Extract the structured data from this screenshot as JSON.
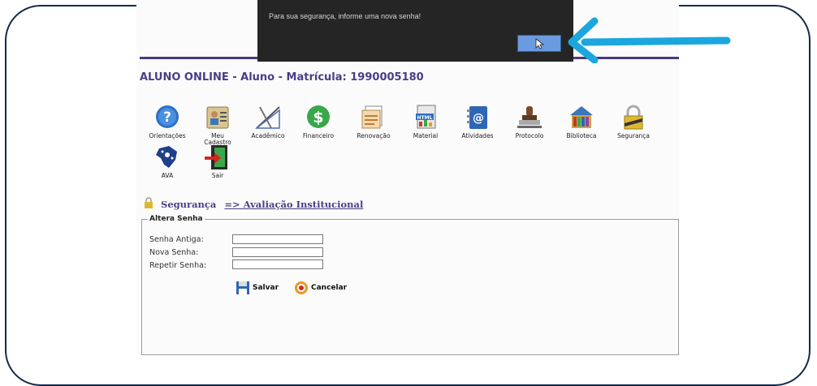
{
  "alert": {
    "message": "Para sua segurança, informe uma nova senha!"
  },
  "header": {
    "title": "ALUNO ONLINE - Aluno - Matrícula: 1990005180"
  },
  "menu": [
    {
      "label": "Orientações",
      "icon": "question-icon"
    },
    {
      "label": "Meu\nCadastro",
      "icon": "id-card-icon"
    },
    {
      "label": "Acadêmico",
      "icon": "drafting-tools-icon"
    },
    {
      "label": "Financeiro",
      "icon": "dollar-icon"
    },
    {
      "label": "Renovação",
      "icon": "documents-icon"
    },
    {
      "label": "Material",
      "icon": "html-file-icon"
    },
    {
      "label": "Atividades",
      "icon": "address-book-icon"
    },
    {
      "label": "Protocolo",
      "icon": "stamp-icon"
    },
    {
      "label": "Biblioteca",
      "icon": "library-icon"
    },
    {
      "label": "Segurança",
      "icon": "padlock-icon"
    },
    {
      "label": "AVA",
      "icon": "brazil-map-icon"
    },
    {
      "label": "Sair",
      "icon": "exit-door-icon"
    }
  ],
  "breadcrumb": {
    "section": "Segurança",
    "link": "=> Avaliação Institucional"
  },
  "form": {
    "legend": "Altera Senha",
    "fields": [
      {
        "label": "Senha Antiga:",
        "value": ""
      },
      {
        "label": "Nova Senha:",
        "value": ""
      },
      {
        "label": "Repetir Senha:",
        "value": ""
      }
    ],
    "save_label": "Salvar",
    "cancel_label": "Cancelar"
  },
  "colors": {
    "accent": "#4b3d86",
    "annotation_arrow": "#1ba6de",
    "dialog_bg": "#252525",
    "ok_button": "#6a9be0"
  }
}
